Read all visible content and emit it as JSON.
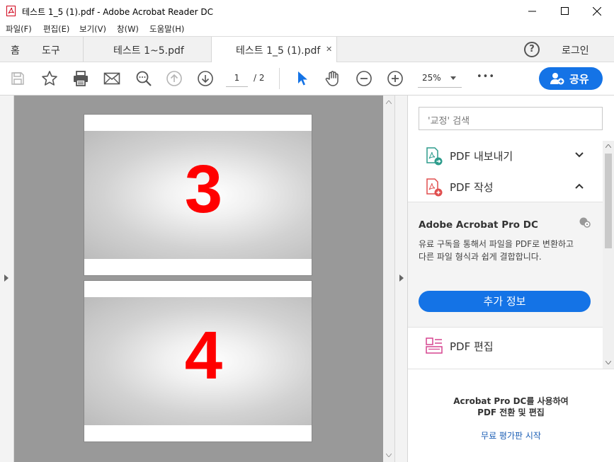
{
  "window": {
    "title": "테스트 1_5 (1).pdf - Adobe Acrobat Reader DC"
  },
  "menu": [
    "파일(F)",
    "편집(E)",
    "보기(V)",
    "창(W)",
    "도움말(H)"
  ],
  "tabs": {
    "home": "홈",
    "tools": "도구",
    "doc1": "테스트 1~5.pdf",
    "doc2": "테스트 1_5 (1).pdf",
    "close_glyph": "✕",
    "help_glyph": "?",
    "login": "로그인"
  },
  "toolbar": {
    "page_current": "1",
    "page_total": "/ 2",
    "zoom": "25%",
    "more": "•••",
    "share_label": "공유"
  },
  "document": {
    "pages": [
      {
        "number": "3"
      },
      {
        "number": "4"
      }
    ]
  },
  "right_panel": {
    "search_placeholder": "'교정' 검색",
    "tools": [
      {
        "label": "PDF 내보내기",
        "icon": "export-pdf-icon",
        "state": "collapsed"
      },
      {
        "label": "PDF 작성",
        "icon": "create-pdf-icon",
        "state": "expanded"
      },
      {
        "label": "PDF 편집",
        "icon": "edit-pdf-icon",
        "state": "none"
      }
    ],
    "promo": {
      "title": "Adobe Acrobat Pro DC",
      "description": "유료 구독을 통해서 파일을 PDF로 변환하고 다른 파일 형식과 쉽게 결합합니다.",
      "button": "추가 정보"
    },
    "bottom": {
      "line1": "Acrobat Pro DC를 사용하여",
      "line2": "PDF 전환 및 편집",
      "link": "무료 평가판 시작"
    }
  },
  "colors": {
    "accent": "#1473e6",
    "page_number": "#ff0000",
    "doc_background": "#999999"
  }
}
